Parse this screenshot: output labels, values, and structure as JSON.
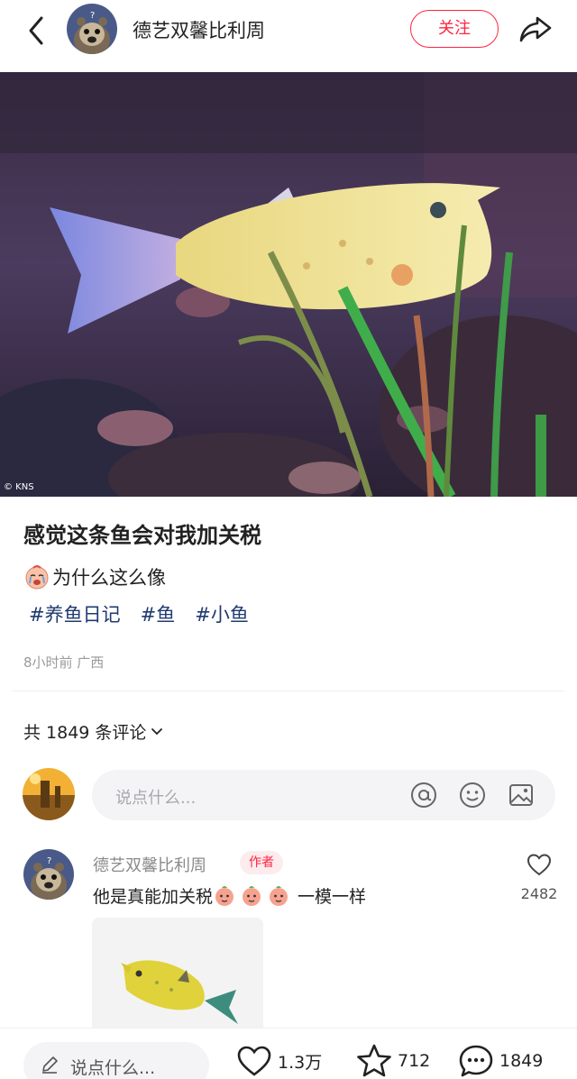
{
  "header": {
    "author_name": "德艺双馨比利周",
    "follow_label": "关注"
  },
  "image": {
    "watermark": "© KNS"
  },
  "note": {
    "title": "感觉这条鱼会对我加关税",
    "description": "为什么这么像",
    "tags": [
      "#养鱼日记",
      "#鱼",
      "#小鱼"
    ],
    "meta": "8小时前 广西"
  },
  "comments": {
    "count_label": "共 1849 条评论",
    "input_placeholder": "说点什么...",
    "items": [
      {
        "author": "德艺双馨比利周",
        "badge": "作者",
        "text_prefix": "他是真能加关税",
        "text_suffix": "一模一样",
        "likes": "2482"
      }
    ]
  },
  "bottom_bar": {
    "input_placeholder": "说点什么...",
    "likes": "1.3万",
    "favorites": "712",
    "comments": "1849"
  },
  "colors": {
    "accent": "#ff2442",
    "tag": "#1f3a70"
  }
}
